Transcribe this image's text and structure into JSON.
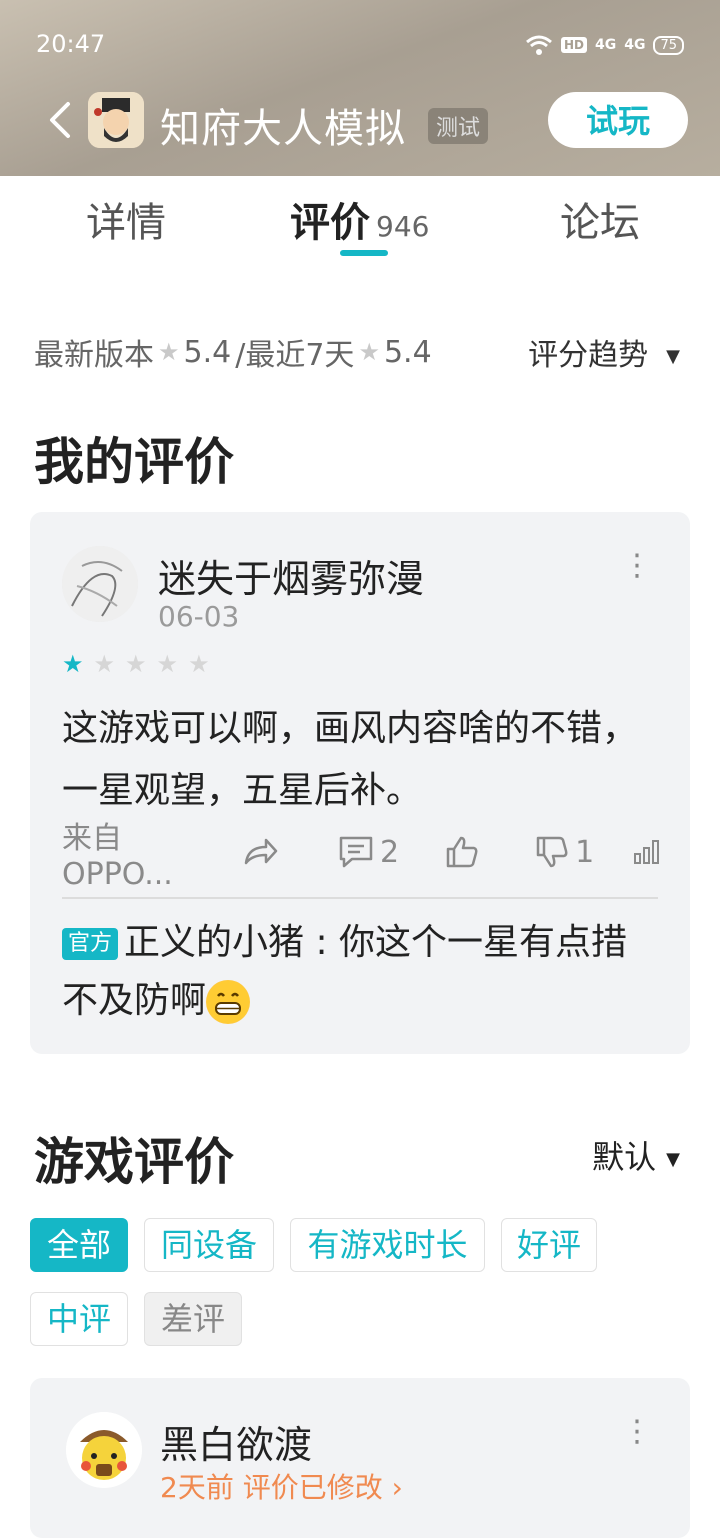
{
  "status": {
    "time": "20:47",
    "hd": "HD",
    "net1": "4G",
    "net2": "4G",
    "battery": "75"
  },
  "header": {
    "title": "知府大人模拟",
    "badge": "测试",
    "try_label": "试玩"
  },
  "tabs": [
    {
      "label": "详情"
    },
    {
      "label": "评价",
      "count": "946"
    },
    {
      "label": "论坛"
    }
  ],
  "rating": {
    "latest_label": "最新版本",
    "latest_score": "5.4",
    "sep": "/最近7天",
    "recent_score": "5.4",
    "trend_label": "评分趋势"
  },
  "my_review": {
    "section_title": "我的评价",
    "user": "迷失于烟雾弥漫",
    "date": "06-03",
    "stars": 1,
    "text": "这游戏可以啊，画风内容啥的不错，一星观望，五星后补。",
    "device": "来自OPPO...",
    "comments": "2",
    "dislikes": "1",
    "reply_badge": "官方",
    "reply_text": "正义的小猪 : 你这个一星有点措不及防啊"
  },
  "game_reviews": {
    "section_title": "游戏评价",
    "sort_label": "默认",
    "filters": [
      "全部",
      "同设备",
      "有游戏时长",
      "好评",
      "中评",
      "差评"
    ],
    "first": {
      "user": "黑白欲渡",
      "meta": "2天前 评价已修改"
    }
  },
  "colors": {
    "accent": "#15b7c6",
    "orange": "#f08a50"
  }
}
